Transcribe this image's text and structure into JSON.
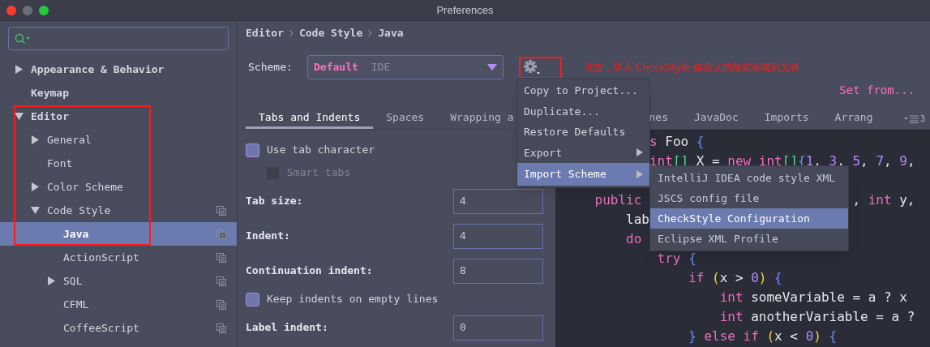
{
  "window": {
    "title": "Preferences"
  },
  "sidebar": {
    "tree": [
      {
        "label": "Appearance & Behavior",
        "expanded": false,
        "copyable": false,
        "selected": false
      },
      {
        "label": "Keymap",
        "copyable": false,
        "selected": false
      },
      {
        "label": "Editor",
        "expanded": true,
        "copyable": false,
        "selected": false,
        "children": [
          {
            "label": "General",
            "expanded": false,
            "copyable": false,
            "selected": false
          },
          {
            "label": "Font",
            "copyable": false,
            "selected": false
          },
          {
            "label": "Color Scheme",
            "expanded": false,
            "copyable": false,
            "selected": false
          },
          {
            "label": "Code Style",
            "expanded": true,
            "copyable": true,
            "selected": false,
            "children": [
              {
                "label": "Java",
                "copyable": true,
                "selected": true
              },
              {
                "label": "ActionScript",
                "copyable": true,
                "selected": false
              },
              {
                "label": "SQL",
                "expanded": false,
                "copyable": true,
                "selected": false
              },
              {
                "label": "CFML",
                "copyable": true,
                "selected": false
              },
              {
                "label": "CoffeeScript",
                "copyable": true,
                "selected": false
              }
            ]
          }
        ]
      }
    ]
  },
  "breadcrumb": [
    "Editor",
    "Code Style",
    "Java"
  ],
  "scheme": {
    "label": "Scheme:",
    "value": "Default",
    "sub_value": "IDE"
  },
  "annotation": "点击，导入 CheckStyle 自定义的格式化规则文件",
  "set_from": "Set from...",
  "tabs": [
    {
      "label": "Tabs and Indents",
      "selected": true,
      "kind": "full"
    },
    {
      "label": "Spaces",
      "selected": false,
      "kind": "full"
    },
    {
      "label": "Wrapping a",
      "selected": false,
      "kind": "cut-right"
    },
    {
      "label": "nes",
      "selected": false,
      "kind": "cut-left"
    },
    {
      "label": "JavaDoc",
      "selected": false,
      "kind": "full"
    },
    {
      "label": "Imports",
      "selected": false,
      "kind": "full"
    },
    {
      "label": "Arrang",
      "selected": false,
      "kind": "full"
    }
  ],
  "tabs_overflow": {
    "count": "3"
  },
  "settings": [
    {
      "kind": "checkbox",
      "label": "Use tab character",
      "checked": false,
      "disabled": false,
      "children": [
        {
          "kind": "checkbox",
          "label": "Smart tabs",
          "checked": false,
          "disabled": true
        }
      ]
    },
    {
      "kind": "field",
      "label": "Tab size:",
      "value": "4"
    },
    {
      "kind": "field",
      "label": "Indent:",
      "value": "4"
    },
    {
      "kind": "field",
      "label": "Continuation indent:",
      "value": "8"
    },
    {
      "kind": "checkbox",
      "label": "Keep indents on empty lines",
      "checked": false,
      "disabled": false
    },
    {
      "kind": "field",
      "label": "Label indent:",
      "value": "0"
    }
  ],
  "code": [
    {
      "kind": "text",
      "segments": [
        {
          "tokens": [
            {
              "text": "           s",
              "kind": "keyword"
            },
            {
              "text": " Foo ",
              "kind": "plain"
            },
            {
              "text": "{",
              "kind": "brace"
            }
          ]
        }
      ]
    },
    {
      "kind": "text",
      "segments": [
        {
          "tokens": [
            {
              "text": "           int",
              "kind": "keyword"
            },
            {
              "text": "[]",
              "kind": "bracket"
            },
            {
              "text": " X = ",
              "kind": "plain"
            },
            {
              "text": "new",
              "kind": "keyword"
            },
            {
              "text": " int",
              "kind": "keyword"
            },
            {
              "text": "[]",
              "kind": "bracket"
            },
            {
              "text": "{",
              "kind": "brace"
            },
            {
              "text": "1",
              "kind": "number"
            },
            {
              "text": ", ",
              "kind": "plain"
            },
            {
              "text": "3",
              "kind": "number"
            },
            {
              "text": ", ",
              "kind": "plain"
            },
            {
              "text": "5",
              "kind": "number"
            },
            {
              "text": ", ",
              "kind": "plain"
            },
            {
              "text": "7",
              "kind": "number"
            },
            {
              "text": ", ",
              "kind": "plain"
            },
            {
              "text": "9",
              "kind": "number"
            },
            {
              "text": ",",
              "kind": "plain"
            }
          ]
        }
      ]
    },
    {
      "kind": "blank"
    },
    {
      "kind": "text",
      "segments": [
        {
          "tokens": [
            {
              "text": "    public",
              "kind": "keyword"
            }
          ]
        },
        {
          "tokens": [
            {
              "text": "                           , ",
              "kind": "plain"
            },
            {
              "text": "int",
              "kind": "keyword"
            },
            {
              "text": " y,",
              "kind": "plain"
            }
          ]
        }
      ]
    },
    {
      "kind": "text",
      "segments": [
        {
          "tokens": [
            {
              "text": "        lab",
              "kind": "plain"
            }
          ]
        }
      ]
    },
    {
      "kind": "text",
      "segments": [
        {
          "tokens": [
            {
              "text": "        do",
              "kind": "keyword"
            }
          ]
        }
      ]
    },
    {
      "kind": "text",
      "segments": [
        {
          "tokens": [
            {
              "text": "            try",
              "kind": "keyword"
            },
            {
              "text": " {",
              "kind": "brace"
            }
          ]
        }
      ]
    },
    {
      "kind": "text",
      "segments": [
        {
          "tokens": [
            {
              "text": "                if",
              "kind": "keyword"
            },
            {
              "text": " (",
              "kind": "paren"
            },
            {
              "text": "x > ",
              "kind": "plain"
            },
            {
              "text": "0",
              "kind": "number"
            },
            {
              "text": ")",
              "kind": "paren"
            },
            {
              "text": " {",
              "kind": "brace"
            }
          ]
        }
      ]
    },
    {
      "kind": "text",
      "segments": [
        {
          "tokens": [
            {
              "text": "                    int",
              "kind": "keyword"
            },
            {
              "text": " someVariable = a ? x",
              "kind": "plain"
            }
          ]
        }
      ]
    },
    {
      "kind": "text",
      "segments": [
        {
          "tokens": [
            {
              "text": "                    int",
              "kind": "keyword"
            },
            {
              "text": " anotherVariable = a ?",
              "kind": "plain"
            }
          ]
        }
      ]
    },
    {
      "kind": "text",
      "segments": [
        {
          "tokens": [
            {
              "text": "                }",
              "kind": "brace"
            },
            {
              "text": " else if",
              "kind": "keyword"
            },
            {
              "text": " (",
              "kind": "paren"
            },
            {
              "text": "x < ",
              "kind": "plain"
            },
            {
              "text": "0",
              "kind": "number"
            },
            {
              "text": ")",
              "kind": "paren"
            },
            {
              "text": " {",
              "kind": "brace"
            }
          ]
        }
      ]
    }
  ],
  "menu": {
    "items": [
      {
        "label": "Copy to Project...",
        "selected": false,
        "submenu": false
      },
      {
        "label": "Duplicate...",
        "selected": false,
        "submenu": false
      },
      {
        "label": "Restore Defaults",
        "selected": false,
        "submenu": false
      },
      {
        "label": "Export",
        "selected": false,
        "submenu": true
      },
      {
        "label": "Import Scheme",
        "selected": true,
        "submenu": true
      }
    ],
    "submenu": [
      {
        "label": "IntelliJ IDEA code style XML",
        "selected": false
      },
      {
        "label": "JSCS config file",
        "selected": false
      },
      {
        "label": "CheckStyle Configuration",
        "selected": true
      },
      {
        "label": "Eclipse XML Profile",
        "selected": false
      }
    ]
  }
}
